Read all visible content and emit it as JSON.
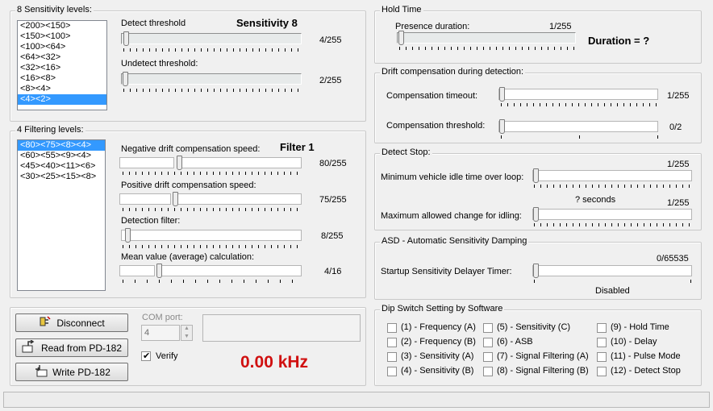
{
  "sensitivity": {
    "title": "8 Sensitivity levels:",
    "levels": [
      "<200><150>",
      "<150><100>",
      "<100><64>",
      "<64><32>",
      "<32><16>",
      "<16><8>",
      "<8><4>",
      "<4><2>"
    ],
    "big_label": "Sensitivity 8",
    "detect_label": "Detect threshold",
    "detect_value": "4/255",
    "detect_level": 4,
    "undetect_label": "Undetect threshold:",
    "undetect_value": "2/255",
    "undetect_level": 2
  },
  "filtering": {
    "title": "4 Filtering levels:",
    "levels": [
      "<80><75><8><4>",
      "<60><55><9><4>",
      "<45><40><11><6>",
      "<30><25><15><8>"
    ],
    "big_label": "Filter 1",
    "neg_label": "Negative drift compensation speed:",
    "neg_value": "80/255",
    "pos_label": "Positive drift compensation speed:",
    "pos_value": "75/255",
    "det_label": "Detection filter:",
    "det_value": "8/255",
    "mean_label": "Mean value (average) calculation:",
    "mean_value": "4/16"
  },
  "hold_time": {
    "title": "Hold Time",
    "presence_label": "Presence duration:",
    "presence_value": "1/255",
    "duration_label": "Duration = ?"
  },
  "drift": {
    "title": "Drift compensation during detection:",
    "timeout_label": "Compensation timeout:",
    "timeout_value": "1/255",
    "threshold_label": "Compensation threshold:",
    "threshold_value": "0/2"
  },
  "detect_stop": {
    "title": "Detect Stop:",
    "idle_label": "Minimum vehicle idle time over loop:",
    "idle_value": "1/255",
    "seconds": "? seconds",
    "change_label": "Maximum allowed change for idling:",
    "change_value": "1/255"
  },
  "asd": {
    "title": "ASD - Automatic Sensitivity Damping",
    "timer_label": "Startup Sensitivity Delayer Timer:",
    "timer_value": "0/65535",
    "status": "Disabled"
  },
  "dip": {
    "title": "Dip Switch Setting by Software",
    "items": [
      "(1) - Frequency (A)",
      "(2) - Frequency (B)",
      "(3) - Sensitivity (A)",
      "(4) - Sensitivity (B)",
      "(5) - Sensitivity (C)",
      "(6) - ASB",
      "(7) - Signal Filtering (A)",
      "(8) - Signal Filtering (B)",
      "(9) - Hold Time",
      "(10) - Delay",
      "(11) - Pulse Mode",
      "(12) - Detect Stop"
    ]
  },
  "connection": {
    "disconnect": "Disconnect",
    "read": "Read from PD-182",
    "write": "Write PD-182",
    "com_label": "COM port:",
    "com_value": "4",
    "verify": "Verify",
    "verify_checked": true,
    "frequency": "0.00 kHz",
    "frequency_color": "#d01010"
  }
}
